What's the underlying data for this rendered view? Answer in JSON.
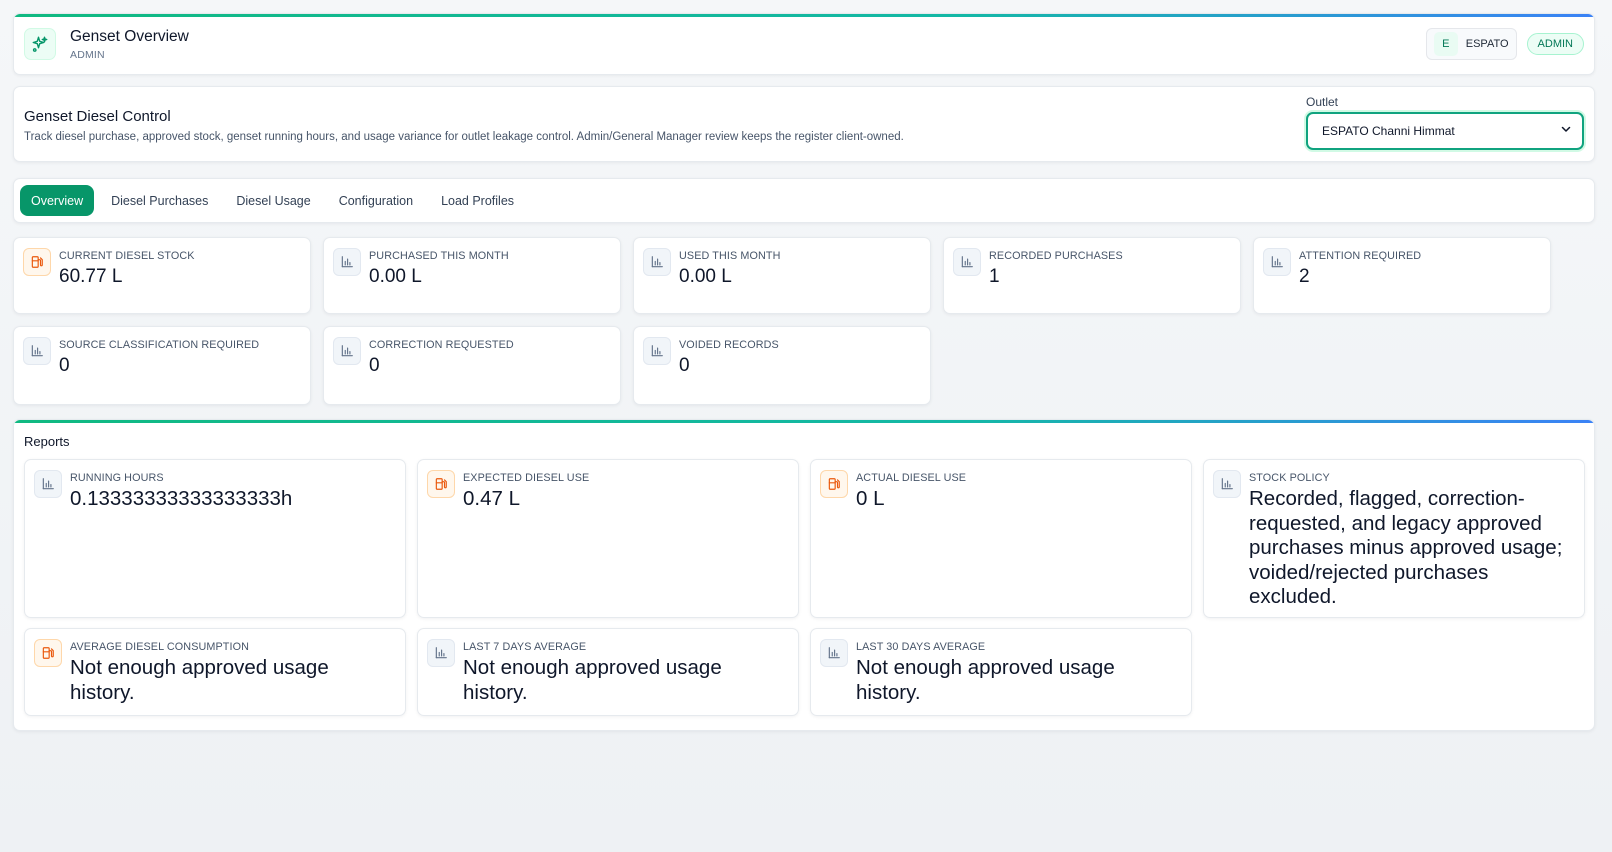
{
  "header": {
    "title": "Genset Overview",
    "subtitle": "ADMIN",
    "org_initial": "E",
    "org_name": "ESPATO",
    "role": "ADMIN"
  },
  "control": {
    "title": "Genset Diesel Control",
    "description": "Track diesel purchase, approved stock, genset running hours, and usage variance for outlet leakage control. Admin/General Manager review keeps the register client-owned.",
    "outlet_label": "Outlet",
    "outlet_value": "ESPATO Channi Himmat"
  },
  "tabs": [
    {
      "label": "Overview",
      "active": true
    },
    {
      "label": "Diesel Purchases"
    },
    {
      "label": "Diesel Usage"
    },
    {
      "label": "Configuration"
    },
    {
      "label": "Load Profiles"
    }
  ],
  "metrics": [
    {
      "label": "CURRENT DIESEL STOCK",
      "value": "60.77 L",
      "icon": "fuel-icon"
    },
    {
      "label": "PURCHASED THIS MONTH",
      "value": "0.00 L",
      "icon": "chart-icon"
    },
    {
      "label": "USED THIS MONTH",
      "value": "0.00 L",
      "icon": "chart-icon"
    },
    {
      "label": "RECORDED PURCHASES",
      "value": "1",
      "icon": "chart-icon"
    },
    {
      "label": "ATTENTION REQUIRED",
      "value": "2",
      "icon": "chart-icon"
    },
    {
      "label": "SOURCE CLASSIFICATION REQUIRED",
      "value": "0",
      "icon": "chart-icon"
    },
    {
      "label": "CORRECTION REQUESTED",
      "value": "0",
      "icon": "chart-icon"
    },
    {
      "label": "VOIDED RECORDS",
      "value": "0",
      "icon": "chart-icon"
    }
  ],
  "reports": {
    "title": "Reports",
    "items": [
      {
        "label": "RUNNING HOURS",
        "value": "0.13333333333333333h",
        "icon": "chart-icon"
      },
      {
        "label": "EXPECTED DIESEL USE",
        "value": "0.47 L",
        "icon": "fuel-icon"
      },
      {
        "label": "ACTUAL DIESEL USE",
        "value": "0 L",
        "icon": "fuel-icon"
      },
      {
        "label": "STOCK POLICY",
        "value": "Recorded, flagged, correction-requested, and legacy approved purchases minus approved usage; voided/rejected purchases excluded.",
        "icon": "chart-icon"
      },
      {
        "label": "AVERAGE DIESEL CONSUMPTION",
        "value": "Not enough approved usage history.",
        "icon": "fuel-icon"
      },
      {
        "label": "LAST 7 DAYS AVERAGE",
        "value": "Not enough approved usage history.",
        "icon": "chart-icon"
      },
      {
        "label": "LAST 30 DAYS AVERAGE",
        "value": "Not enough approved usage history.",
        "icon": "chart-icon"
      }
    ]
  },
  "colors": {
    "accent": "#079669",
    "fuel_icon": "#ea580c",
    "chart_icon": "#64748b"
  }
}
